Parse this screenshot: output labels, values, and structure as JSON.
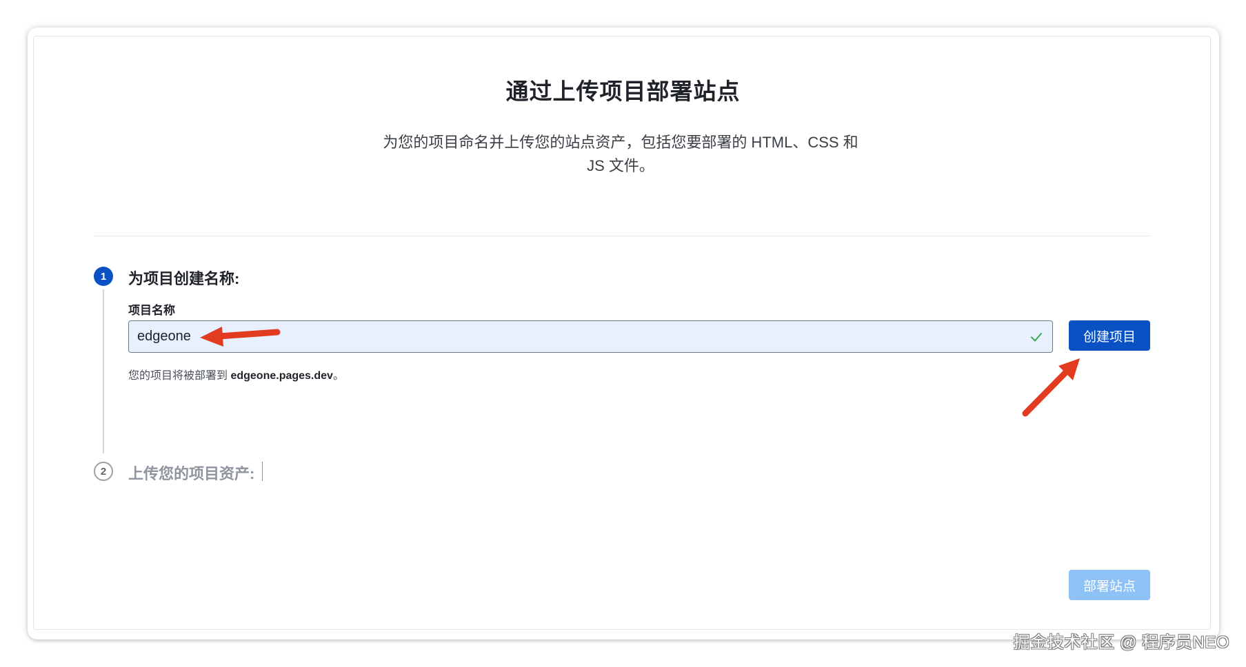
{
  "header": {
    "title": "通过上传项目部署站点",
    "subtitle": "为您的项目命名并上传您的站点资产，包括您要部署的 HTML、CSS 和 JS 文件。"
  },
  "steps": [
    {
      "number": "1",
      "title": "为项目创建名称:",
      "state": "active",
      "field_label": "项目名称",
      "input_value": "edgeone",
      "input_valid_icon": "check-icon",
      "helper_prefix": "您的项目将被部署到 ",
      "helper_domain": "edgeone.pages.dev",
      "helper_suffix": "。",
      "action_label": "创建项目"
    },
    {
      "number": "2",
      "title": "上传您的项目资产:",
      "state": "inactive"
    }
  ],
  "footer": {
    "deploy_label": "部署站点",
    "deploy_enabled": false
  },
  "watermark": "掘金技术社区 @ 程序员NEO",
  "colors": {
    "primary": "#0a52c4",
    "primary_disabled": "#8ec2f7",
    "input_bg": "#e8f0fe",
    "annotation_arrow": "#e23b1f",
    "valid_check": "#3aa55a"
  }
}
